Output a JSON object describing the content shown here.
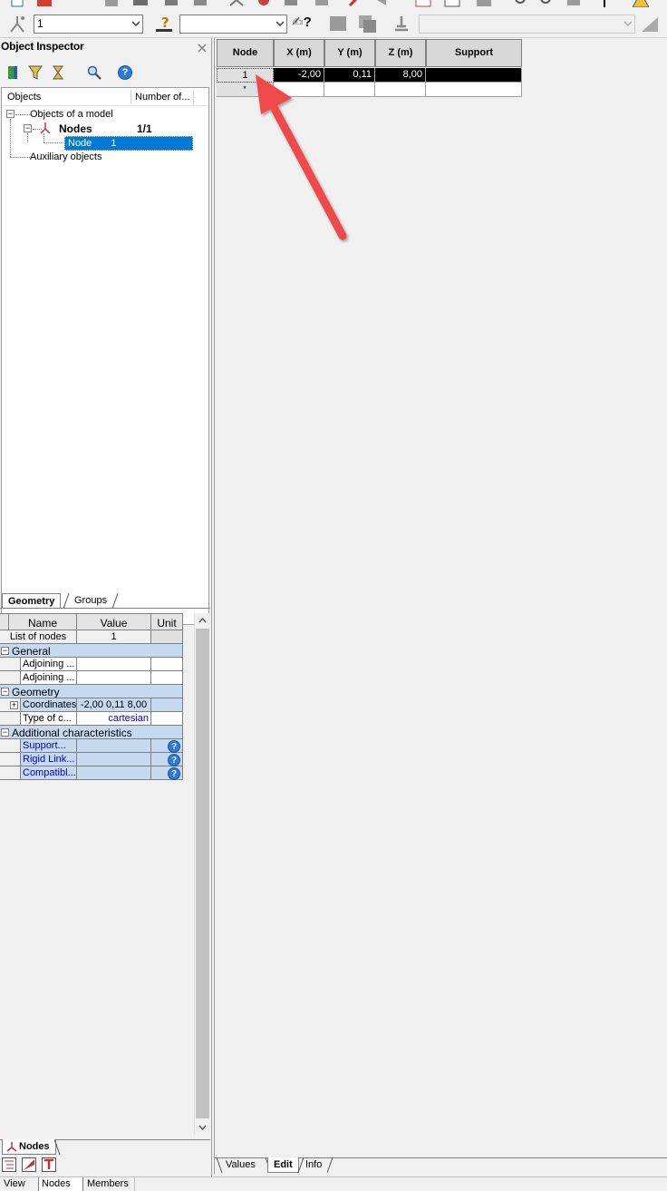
{
  "toolbar": {
    "node_combo_value": "1",
    "help_glyph": "?",
    "arrow_down_icon": "chevron-down-icon"
  },
  "object_inspector": {
    "title": "Object Inspector",
    "columns": {
      "objects": "Objects",
      "number": "Number of..."
    },
    "tree": {
      "root": "Objects of a model",
      "nodes_label": "Nodes",
      "nodes_count": "1/1",
      "node_item": "Node",
      "node_item_num": "1",
      "auxiliary": "Auxiliary objects"
    },
    "tabs": [
      "Geometry",
      "Groups"
    ]
  },
  "properties": {
    "headers": {
      "name": "Name",
      "value": "Value",
      "unit": "Unit"
    },
    "list_of_nodes": {
      "name": "List of nodes",
      "value": "1"
    },
    "general": {
      "label": "General",
      "rows": [
        {
          "name": "Adjoining ..."
        },
        {
          "name": "Adjoining ..."
        }
      ]
    },
    "geometry": {
      "label": "Geometry",
      "coordinates": {
        "name": "Coordinates",
        "value": "-2,00 0,11 8,00"
      },
      "type": {
        "name": "Type of c...",
        "value": "cartesian"
      }
    },
    "additional": {
      "label": "Additional characteristics",
      "rows": [
        {
          "name": "Support..."
        },
        {
          "name": "Rigid Link..."
        },
        {
          "name": "Compatibl..."
        }
      ]
    }
  },
  "left_bottom_tab": "Nodes",
  "table": {
    "headers": [
      "Node",
      "X (m)",
      "Y (m)",
      "Z (m)",
      "Support"
    ],
    "rows": [
      {
        "node": "1",
        "x": "-2,00",
        "y": "0,11",
        "z": "8,00",
        "support": ""
      }
    ],
    "new_row_marker": "*"
  },
  "right_tabs": [
    "Values",
    "Edit",
    "Info"
  ],
  "status_tabs": [
    "View",
    "Nodes",
    "Members"
  ],
  "colors": {
    "selection": "#0078d7",
    "category": "#c5d9f1",
    "arrow": "#f04848"
  }
}
